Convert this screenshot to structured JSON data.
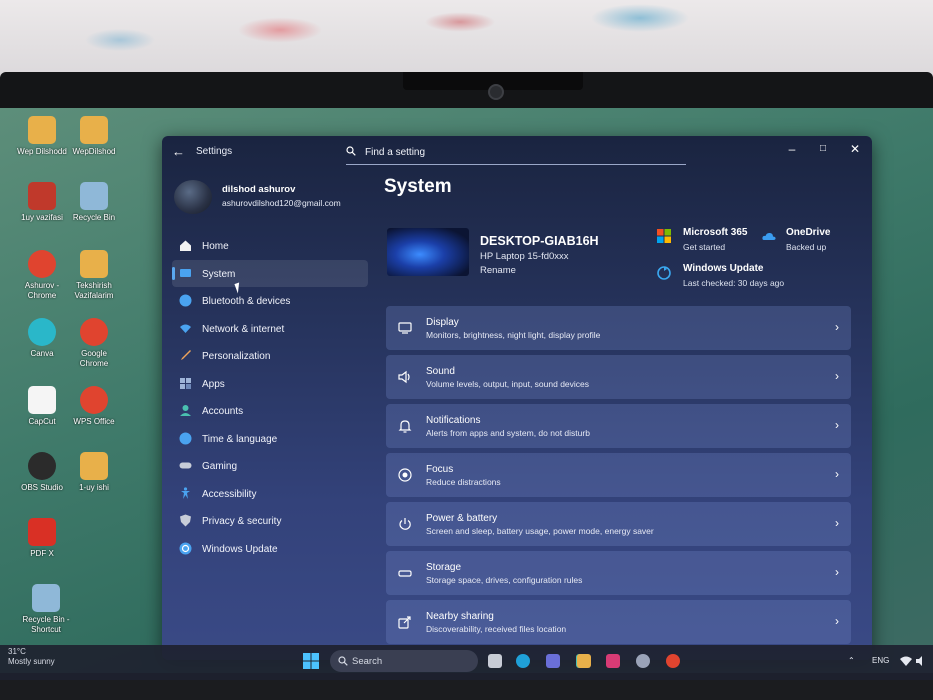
{
  "settings": {
    "window_title": "Settings",
    "search_placeholder": "Find a setting",
    "profile": {
      "name": "dilshod ashurov",
      "email": "ashurovdilshod120@gmail.com"
    },
    "nav": [
      {
        "label": "Home",
        "icon": "home-icon",
        "color": "#f3f3f3"
      },
      {
        "label": "System",
        "icon": "display-icon",
        "color": "#4aa3f0",
        "selected": true
      },
      {
        "label": "Bluetooth & devices",
        "icon": "bluetooth-icon",
        "color": "#4aa3f0"
      },
      {
        "label": "Network & internet",
        "icon": "wifi-icon",
        "color": "#4aa3f0"
      },
      {
        "label": "Personalization",
        "icon": "brush-icon",
        "color": "#f0a35a"
      },
      {
        "label": "Apps",
        "icon": "apps-icon",
        "color": "#9fb4d8"
      },
      {
        "label": "Accounts",
        "icon": "person-icon",
        "color": "#4ac0b0"
      },
      {
        "label": "Time & language",
        "icon": "globe-icon",
        "color": "#4aa3f0"
      },
      {
        "label": "Gaming",
        "icon": "controller-icon",
        "color": "#c8cdd8"
      },
      {
        "label": "Accessibility",
        "icon": "accessibility-icon",
        "color": "#4aa3f0"
      },
      {
        "label": "Privacy & security",
        "icon": "shield-icon",
        "color": "#c8cdd8"
      },
      {
        "label": "Windows Update",
        "icon": "update-icon",
        "color": "#4aa3f0"
      }
    ],
    "page_title": "System",
    "device": {
      "name": "DESKTOP-GIAB16H",
      "model": "HP Laptop 15-fd0xxx",
      "rename": "Rename"
    },
    "tiles": {
      "m365": {
        "title": "Microsoft 365",
        "sub": "Get started"
      },
      "onedrive": {
        "title": "OneDrive",
        "sub": "Backed up"
      },
      "update": {
        "title": "Windows Update",
        "sub": "Last checked: 30 days ago"
      }
    },
    "cards": [
      {
        "title": "Display",
        "sub": "Monitors, brightness, night light, display profile",
        "icon": "monitor-icon"
      },
      {
        "title": "Sound",
        "sub": "Volume levels, output, input, sound devices",
        "icon": "speaker-icon"
      },
      {
        "title": "Notifications",
        "sub": "Alerts from apps and system, do not disturb",
        "icon": "bell-icon"
      },
      {
        "title": "Focus",
        "sub": "Reduce distractions",
        "icon": "focus-icon"
      },
      {
        "title": "Power & battery",
        "sub": "Screen and sleep, battery usage, power mode, energy saver",
        "icon": "power-icon"
      },
      {
        "title": "Storage",
        "sub": "Storage space, drives, configuration rules",
        "icon": "storage-icon"
      },
      {
        "title": "Nearby sharing",
        "sub": "Discoverability, received files location",
        "icon": "share-icon"
      }
    ]
  },
  "desktop_icons": [
    {
      "label": "Wep Dilshodd",
      "color": "#e8b04a"
    },
    {
      "label": "WepDilshod",
      "color": "#e8b04a"
    },
    {
      "label": "1uy vazifasi",
      "color": "#c0392b"
    },
    {
      "label": "Recycle Bin",
      "color": "#8fb8d8"
    },
    {
      "label": "Ashurov - Chrome",
      "color": "#e0442f"
    },
    {
      "label": "Tekshirish Vazifalarim",
      "color": "#e8b04a"
    },
    {
      "label": "Canva",
      "color": "#2ab7c9"
    },
    {
      "label": "Google Chrome",
      "color": "#e0442f"
    },
    {
      "label": "CapCut",
      "color": "#f5f5f5"
    },
    {
      "label": "WPS Office",
      "color": "#e0442f"
    },
    {
      "label": "OBS Studio",
      "color": "#2b2b2b"
    },
    {
      "label": "1-uy ishi",
      "color": "#e8b04a"
    },
    {
      "label": "PDF X",
      "color": "#d93025"
    },
    {
      "label": "Recycle Bin - Shortcut",
      "color": "#8fb8d8"
    }
  ],
  "desktop_edge_labels": [
    "F",
    "Ashurov - Chrome",
    "r",
    "wep",
    "er",
    "hi"
  ],
  "taskbar": {
    "weather_temp": "31°C",
    "weather_text": "Mostly sunny",
    "search_placeholder": "Search",
    "lang": "ENG",
    "apps": [
      {
        "name": "task-view-icon",
        "color": "#c8ccd6"
      },
      {
        "name": "edge-icon",
        "color": "#1fa0d8"
      },
      {
        "name": "teams-icon",
        "color": "#6a6fd8"
      },
      {
        "name": "copilot-icon",
        "color": "#4ac0b0"
      },
      {
        "name": "file-explorer-icon",
        "color": "#e8b04a"
      },
      {
        "name": "media-player-icon",
        "color": "#d83b75"
      },
      {
        "name": "settings-icon",
        "color": "#9aa3b8"
      },
      {
        "name": "chrome-icon",
        "color": "#e0442f"
      }
    ]
  }
}
